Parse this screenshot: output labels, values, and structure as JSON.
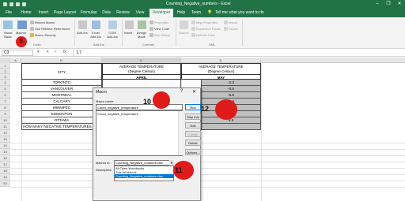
{
  "titlebar": {
    "title": "Counting_Negative_numbers - Excel"
  },
  "window_controls": {
    "minimize": "–",
    "restore": "❐",
    "close": "✕"
  },
  "tabs": [
    {
      "label": "File"
    },
    {
      "label": "Home"
    },
    {
      "label": "Insert"
    },
    {
      "label": "Page Layout"
    },
    {
      "label": "Formulas"
    },
    {
      "label": "Data"
    },
    {
      "label": "Review"
    },
    {
      "label": "View"
    },
    {
      "label": "Developer"
    },
    {
      "label": "Help"
    },
    {
      "label": "Team"
    }
  ],
  "tell_me": "Tell me what you want to do",
  "ribbon": {
    "visual_basic": "Visual Basic",
    "macros": "Macros",
    "record_macro": "Record Macro",
    "use_relative": "Use Relative References",
    "macro_security": "Macro Security",
    "group_code": "Code",
    "addins": "Add-ins",
    "excel_addins": "Excel Add-ins",
    "com_addins": "COM Add-ins",
    "group_addins": "Add-ins",
    "insert": "Insert",
    "design_mode": "Design Mode",
    "properties": "Properties",
    "view_code": "View Code",
    "run_dialog": "Run Dialog",
    "group_controls": "Controls",
    "source": "Source",
    "map_properties": "Map Properties",
    "expansion_packs": "Expansion Packs",
    "refresh_data": "Refresh Data",
    "import": "Import",
    "export": "Export",
    "group_xml": "XML"
  },
  "formula_bar": {
    "name_box": "C3",
    "fx": "fx",
    "value": "1.7"
  },
  "sheet": {
    "columns": [
      "A",
      "B",
      "C",
      "D"
    ],
    "rows": [
      "1",
      "2",
      "3",
      "4",
      "5",
      "6",
      "7",
      "8",
      "9",
      "10",
      "11",
      "12",
      "13",
      "14",
      "15",
      "16",
      "17",
      "18",
      "19",
      "20"
    ],
    "header_city": "CITY",
    "header_temp1": "AVERAGE TEMPERATURE",
    "header_temp2": "(Degree Celsius)",
    "header_april": "APRIL",
    "header_may": "MAY",
    "cities": [
      "TORONTO",
      "VANCOUVER",
      "MONTREAL",
      "CALGARY",
      "WINNIPEG",
      "EDMONTON",
      "OTTAWA",
      "HOW MANY NEGATIVE TEMPERATURES"
    ],
    "may_values": [
      "-2.3",
      "-0.6",
      "-5.6",
      "-1.3",
      "3",
      "1",
      "6.9",
      ""
    ]
  },
  "dialog": {
    "title": "Macro",
    "help": "?",
    "close": "✕",
    "macro_name_label": "Macro name:",
    "macro_name_value": "Count_negative_temperature",
    "list_items": [
      "Count_negative_temperature"
    ],
    "buttons": {
      "run": "Run",
      "step_into": "Step Into",
      "edit": "Edit",
      "create": "Create",
      "delete": "Delete",
      "options": "Options..."
    },
    "macros_in_label": "Macros in:",
    "macros_in_value": "Counting_Negative_numbers.xlsx",
    "macros_in_options": [
      "All Open Workbooks",
      "This Workbook",
      "Counting_Negative_numbers.xlsx"
    ],
    "description_label": "Description"
  },
  "markers": {
    "m8": "8",
    "m10": "10",
    "m11": "11",
    "m12": "12"
  },
  "colors": {
    "excel_green": "#217346",
    "marker_red": "#e01b1b",
    "selection_blue": "#0078d7",
    "shaded_cell": "#bfbfbf"
  }
}
